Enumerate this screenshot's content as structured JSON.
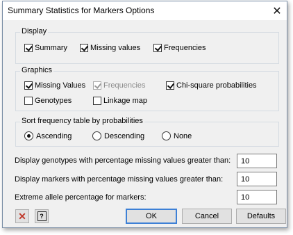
{
  "window": {
    "title": "Summary Statistics for Markers Options",
    "close_icon": "close-icon"
  },
  "display": {
    "label": "Display",
    "items": [
      {
        "label": "Summary",
        "checked": true
      },
      {
        "label": "Missing values",
        "checked": true
      },
      {
        "label": "Frequencies",
        "checked": true
      }
    ]
  },
  "graphics": {
    "label": "Graphics",
    "items": [
      {
        "label": "Missing Values",
        "checked": true,
        "enabled": true
      },
      {
        "label": "Frequencies",
        "checked": true,
        "enabled": false
      },
      {
        "label": "Chi-square probabilities",
        "checked": true,
        "enabled": true
      },
      {
        "label": "Genotypes",
        "checked": false,
        "enabled": true
      },
      {
        "label": "Linkage map",
        "checked": false,
        "enabled": true
      }
    ]
  },
  "sort": {
    "label": "Sort frequency table by probabilities",
    "options": [
      "Ascending",
      "Descending",
      "None"
    ],
    "selected": "Ascending"
  },
  "fields": [
    {
      "label": "Display genotypes with percentage missing values greater than:",
      "value": "10"
    },
    {
      "label": "Display markers with percentage missing values greater than:",
      "value": "10"
    },
    {
      "label": "Extreme allele percentage for markers:",
      "value": "10"
    }
  ],
  "buttons": {
    "ok": "OK",
    "cancel": "Cancel",
    "defaults": "Defaults"
  },
  "colors": {
    "accent": "#3d80d6",
    "reset_icon": "#c0392b",
    "help_icon": "#2b2b2b"
  }
}
